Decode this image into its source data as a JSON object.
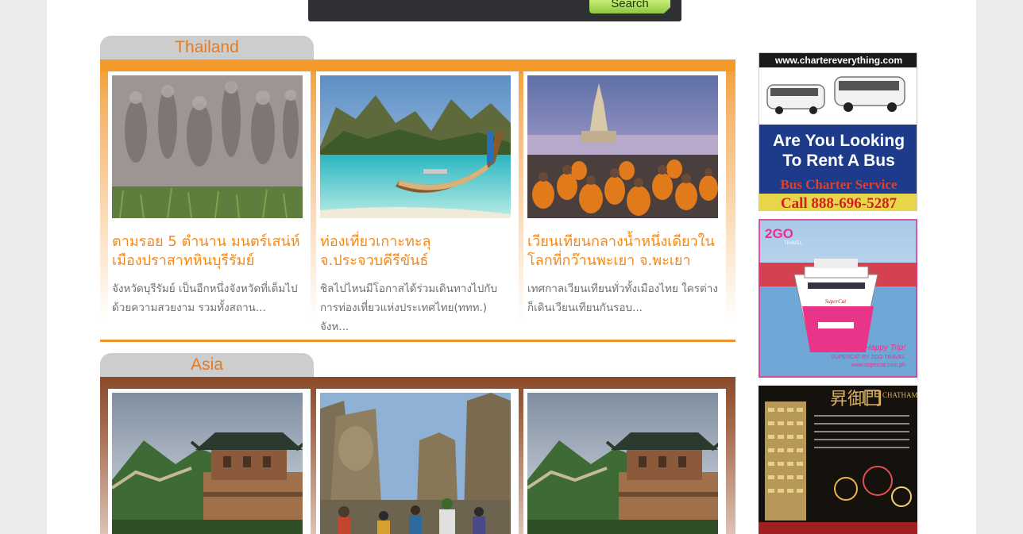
{
  "search": {
    "button_label": "Search"
  },
  "sections": [
    {
      "title": "Thailand",
      "cards": [
        {
          "title": "ตามรอย 5 ตำนาน มนตร์เสน่ห์เมืองปราสาทหินบุรีรัมย์",
          "desc": "จังหวัดบุรีรัมย์ เป็นอีกหนึ่งจังหวัดที่เต็มไปด้วยความสวยงาม รวมทั้งสถาน..."
        },
        {
          "title": "ท่องเที่ยวเกาะทะลุ จ.ประจวบคีรีขันธ์",
          "desc": "ชิลไปไหนมีโอกาสได้ร่วมเดินทางไปกับการท่องเที่ยวแห่งประเทศไทย(ททท.) จังห..."
        },
        {
          "title": "เวียนเทียนกลางน้ำหนึ่งเดียวในโลกที่กว๊านพะเยา จ.พะเยา",
          "desc": "เทศกาลเวียนเทียนทั่วทั้งเมืองไทย ใครต่างก็เดินเวียนเทียนกันรอบ..."
        }
      ]
    },
    {
      "title": "Asia"
    }
  ],
  "ads": {
    "bus": {
      "url": "www.chartereverything.com",
      "headline": "Are You Looking To Rent A Bus",
      "service": "Bus Charter Service",
      "phone": "Call 888-696-5287"
    },
    "ferry": {
      "brand": "2GO",
      "brand_sub": "TRAVEL",
      "ship_name": "SuperCat",
      "tagline": "Happy Trip!",
      "line2": "SUPERCAT BY 2GO TRAVEL",
      "url": "www.supercat.com.ph"
    },
    "hotel": {
      "name_cn": "昇御門",
      "name_en": "CHATHAM GATE"
    }
  }
}
